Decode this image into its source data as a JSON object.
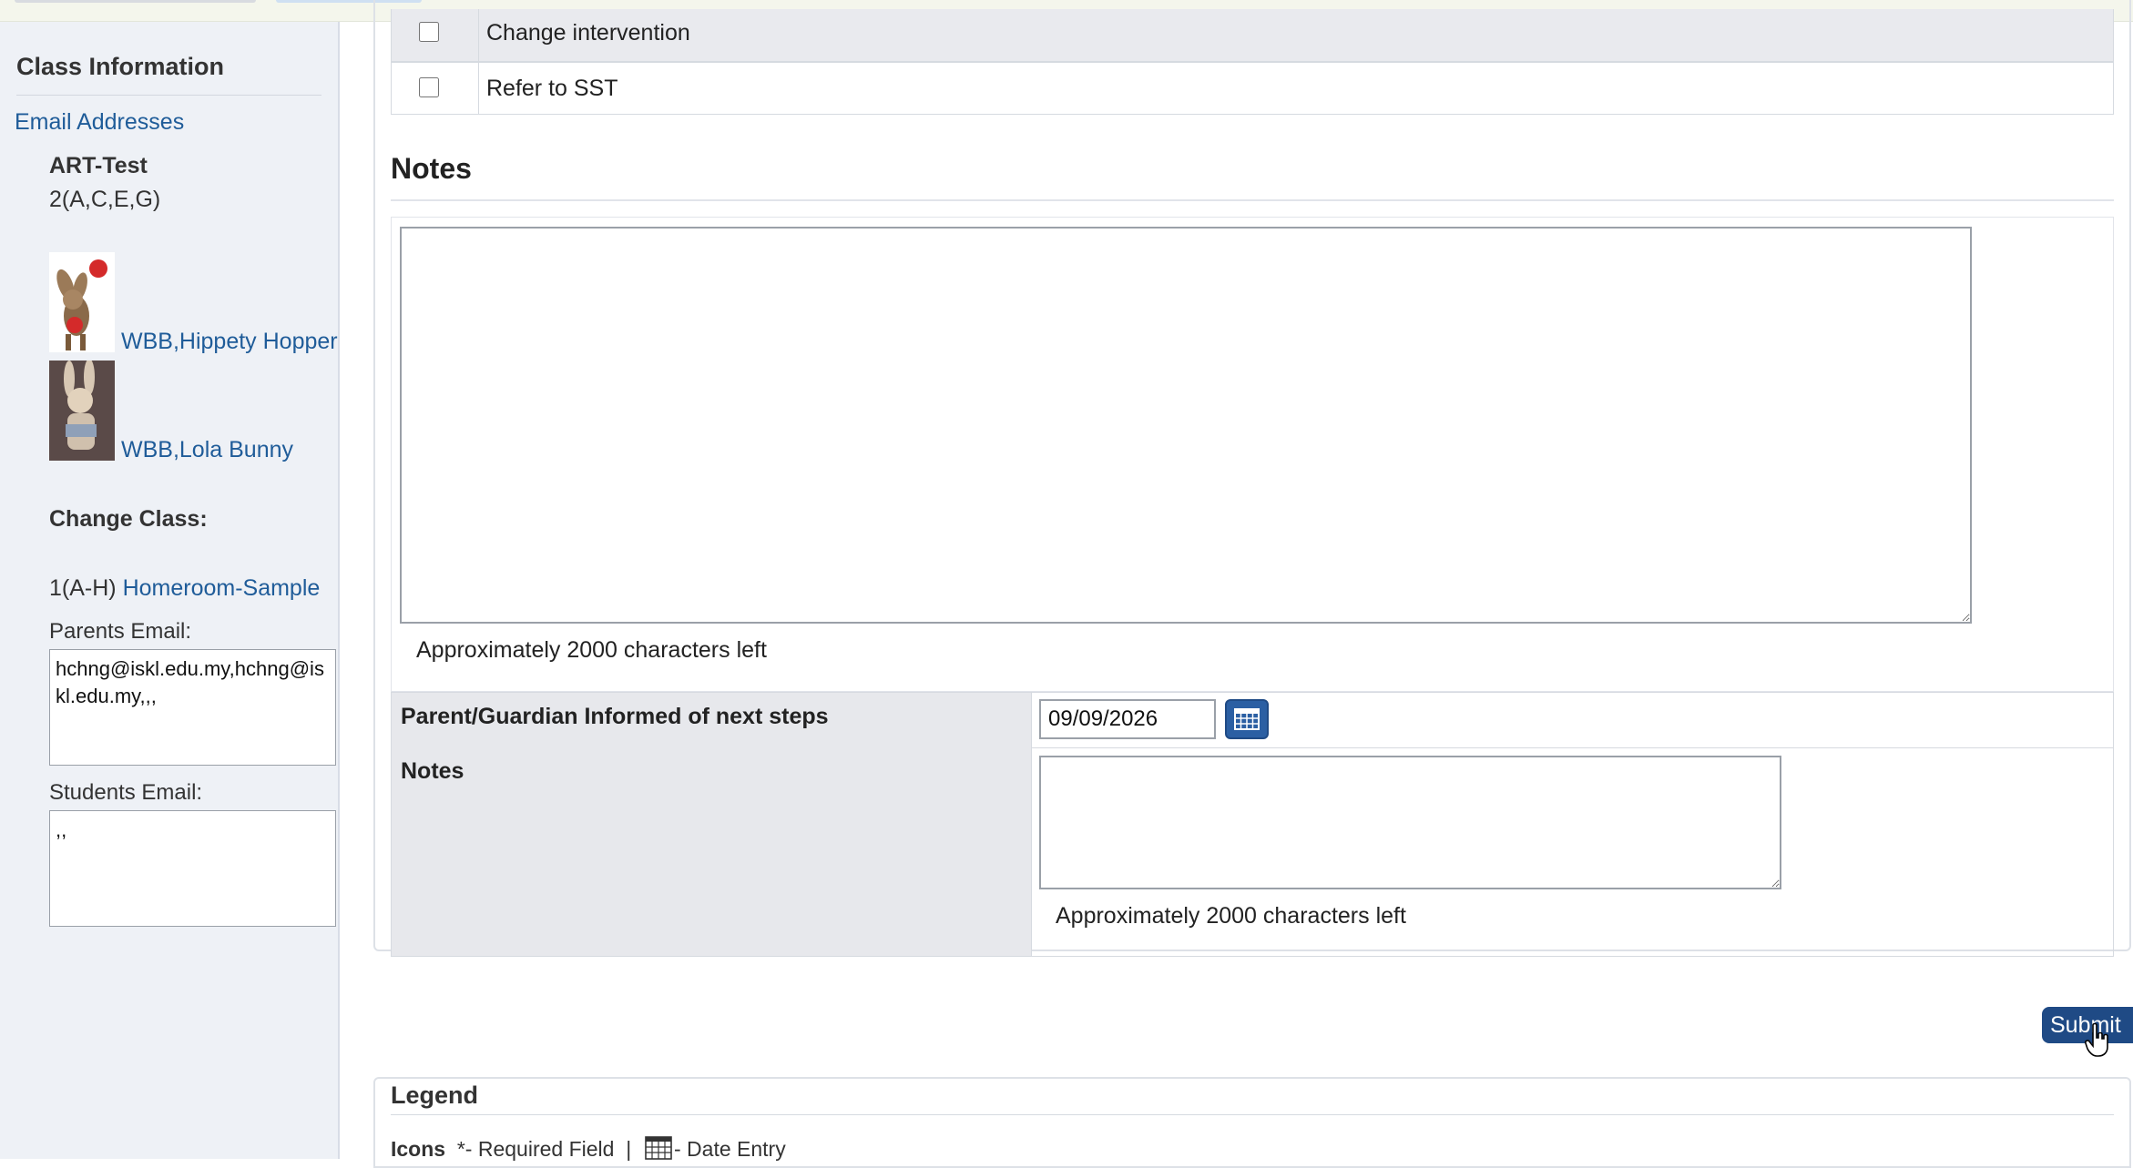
{
  "sidebar": {
    "title": "Class Information",
    "email_link": "Email Addresses",
    "class_name": "ART-Test",
    "class_period": "2(A,C,E,G)",
    "teachers": [
      {
        "prefix": "WBB,",
        "name": "Hippety Hopper"
      },
      {
        "prefix": "WBB,",
        "name": "Lola Bunny"
      }
    ],
    "change_class_label": "Change Class:",
    "homeroom_period": "1(A-H)",
    "homeroom_link": "Homeroom-Sample",
    "parents_email_label": "Parents Email:",
    "parents_email_value": "hchng@iskl.edu.my,hchng@iskl.edu.my,,,",
    "students_email_label": "Students Email:",
    "students_email_value": ",,"
  },
  "checklist": [
    {
      "label": "Change intervention",
      "checked": false
    },
    {
      "label": "Refer to SST",
      "checked": false
    }
  ],
  "notes": {
    "heading": "Notes",
    "chars_left": "Approximately 2000 characters left"
  },
  "parent_informed": {
    "label": "Parent/Guardian Informed of next steps",
    "date_value": "09/09/2026",
    "icon": "calendar-icon"
  },
  "followup_notes": {
    "label": "Notes",
    "chars_left": "Approximately 2000 characters left"
  },
  "submit_label": "Submit",
  "legend": {
    "title": "Legend",
    "icons_label": "Icons",
    "required_text": "*- Required Field",
    "separator": "|",
    "date_entry_text": "- Date Entry"
  },
  "colors": {
    "link": "#1f5c99",
    "button": "#1f4a85",
    "sidebar_bg": "#eef1f6"
  }
}
